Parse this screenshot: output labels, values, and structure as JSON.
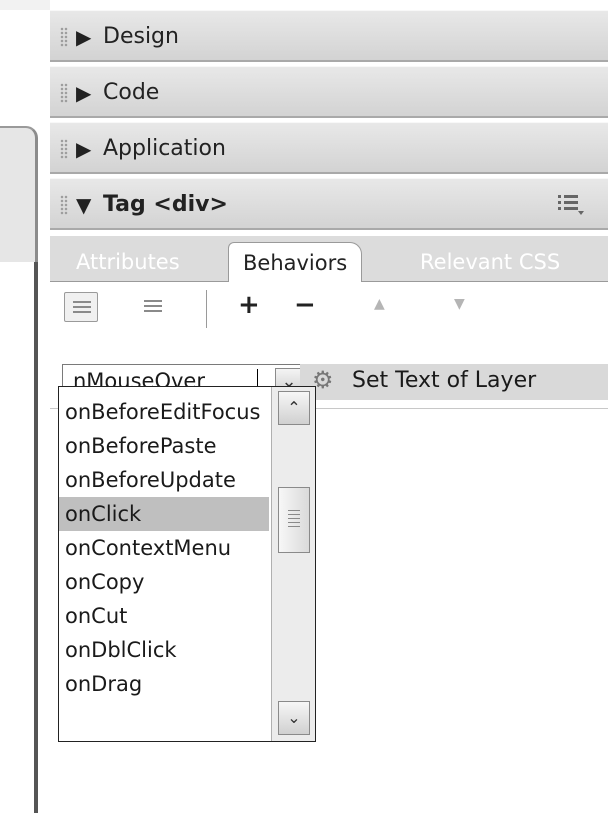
{
  "panels": [
    {
      "label": "Design",
      "arrow": "▶"
    },
    {
      "label": "Code",
      "arrow": "▶"
    },
    {
      "label": "Application",
      "arrow": "▶"
    },
    {
      "label": "Tag <div>",
      "arrow": "▼"
    }
  ],
  "tabs": {
    "attributes": "Attributes",
    "behaviors": "Behaviors",
    "relevant_css": "Relevant CSS",
    "active": "Behaviors"
  },
  "toolbar": {
    "add_symbol": "+",
    "remove_symbol": "−",
    "up_symbol": "▲",
    "down_symbol": "▼"
  },
  "behavior": {
    "event_value": "nMouseOver",
    "action": "Set Text of Layer"
  },
  "event_options": [
    "onBeforeEditFocus",
    "onBeforePaste",
    "onBeforeUpdate",
    "onClick",
    "onContextMenu",
    "onCopy",
    "onCut",
    "onDblClick",
    "onDrag"
  ],
  "selected_option": "onClick",
  "icons": {
    "panel_options": "panel-options-icon",
    "show_set_events": "show-set-events-icon",
    "show_all_events": "show-all-events-icon",
    "action": "gear-icon"
  },
  "colors": {
    "header": "#d9d9d9",
    "selected": "#bfbfbf",
    "action_cell": "#d9d9d9"
  }
}
